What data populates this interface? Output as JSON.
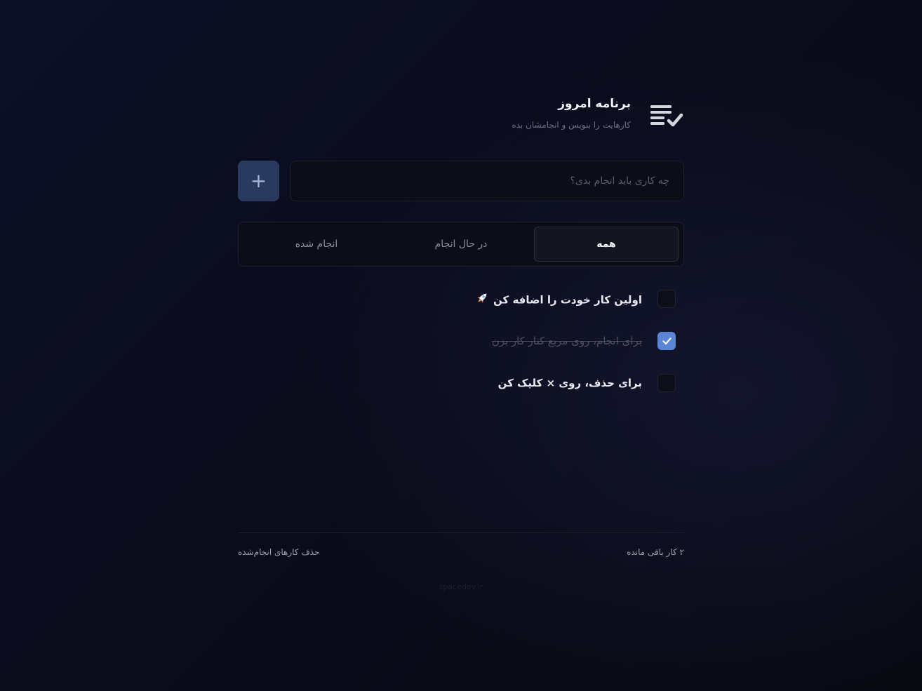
{
  "header": {
    "title": "برنامه امروز",
    "subtitle": "کارهایت را بنویس و انجامشان بده",
    "icon": "checklist-icon"
  },
  "new_task": {
    "placeholder": "چه کاری باید انجام بدی؟",
    "value": "",
    "add_label": "+"
  },
  "tabs": [
    {
      "label": "همه",
      "active": true
    },
    {
      "label": "در حال انجام",
      "active": false
    },
    {
      "label": "انجام شده",
      "active": false
    }
  ],
  "tasks": [
    {
      "text": "اولین کار خودت را اضافه کن",
      "done": false,
      "emoji": "rocket-icon"
    },
    {
      "text": "برای انجام، روی مربع کنار کار بزن",
      "done": true
    },
    {
      "text": "برای حذف، روی × کلیک کن",
      "done": false
    }
  ],
  "footer": {
    "remaining": "۲ کار باقی مانده",
    "clear_done": "حذف کارهای انجام‌شده",
    "credit": "spacedev.ir"
  },
  "colors": {
    "accent": "#5c84d4",
    "add_button": "#2a3a5f",
    "background": "#0a0c1c"
  }
}
